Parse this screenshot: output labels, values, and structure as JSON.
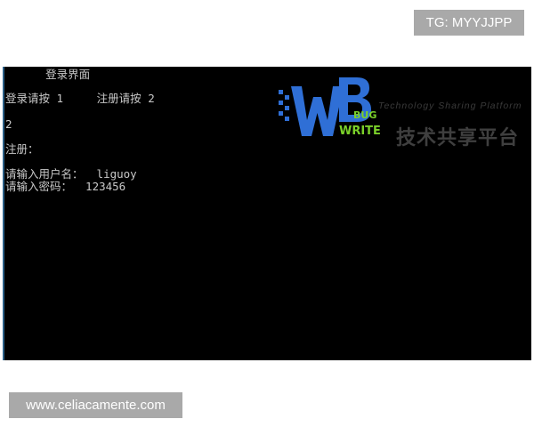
{
  "overlay": {
    "tg_label": "TG: MYYJJPP",
    "site_label": "www.celiacamente.com"
  },
  "console": {
    "lines": [
      "      登录界面",
      "登录请按 1     注册请按 2",
      "2",
      "注册：",
      "请输入用户名：  liguoy",
      "请输入密码：  123456"
    ]
  },
  "watermark": {
    "logo_letters": "WB",
    "logo_bug": "BUG",
    "logo_write": "WRITE",
    "tagline": "Technology Sharing Platform",
    "cn_text": "技术共享平台"
  },
  "colors": {
    "console_bg": "#000000",
    "console_text": "#c8c8c8",
    "badge_bg": "#a9a9a9",
    "logo_blue": "#2f6fd6",
    "logo_green": "#7bd02a"
  }
}
